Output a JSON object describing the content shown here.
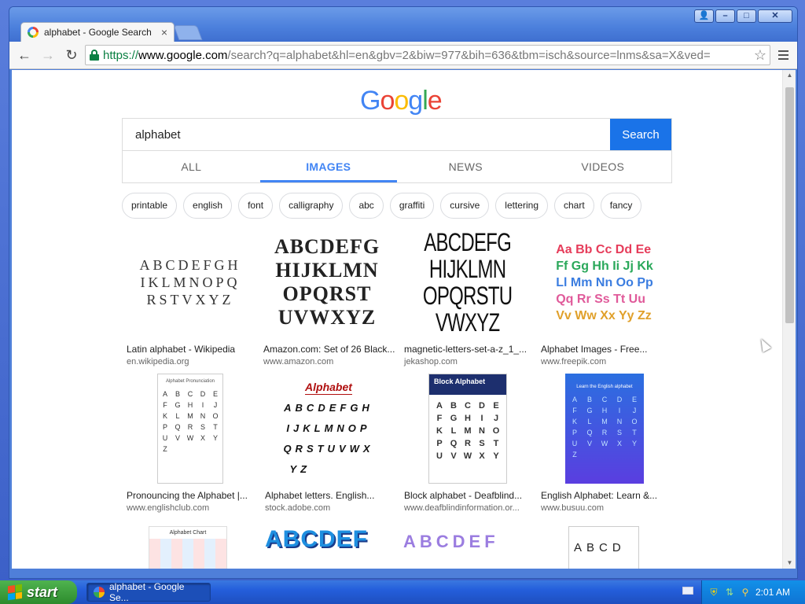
{
  "window": {
    "tab_title": "alphabet - Google Search",
    "tab_close": "×"
  },
  "toolbar": {
    "url_scheme": "https://",
    "url_host": "www.google.com",
    "url_path": "/search?q=alphabet&hl=en&gbv=2&biw=977&bih=636&tbm=isch&source=lnms&sa=X&ved=",
    "back": "←",
    "forward": "→",
    "reload": "↻",
    "star": "☆"
  },
  "page": {
    "logo": [
      "G",
      "o",
      "o",
      "g",
      "l",
      "e"
    ],
    "search": {
      "value": "alphabet",
      "button": "Search"
    },
    "tabs": [
      "ALL",
      "IMAGES",
      "NEWS",
      "VIDEOS"
    ],
    "active_tab": "IMAGES",
    "chips": [
      "printable",
      "english",
      "font",
      "calligraphy",
      "abc",
      "graffiti",
      "cursive",
      "lettering",
      "chart",
      "fancy"
    ],
    "results": [
      {
        "caption": "Latin alphabet - Wikipedia",
        "source": "en.wikipedia.org"
      },
      {
        "caption": "Amazon.com: Set of 26 Black...",
        "source": "www.amazon.com"
      },
      {
        "caption": "magnetic-letters-set-a-z_1_...",
        "source": "jekashop.com"
      },
      {
        "caption": "Alphabet Images - Free...",
        "source": "www.freepik.com"
      },
      {
        "caption": "Pronouncing the Alphabet |...",
        "source": "www.englishclub.com"
      },
      {
        "caption": "Alphabet letters. English...",
        "source": "stock.adobe.com"
      },
      {
        "caption": "Block alphabet - Deafblind...",
        "source": "www.deafblindinformation.or..."
      },
      {
        "caption": "English Alphabet: Learn &...",
        "source": "www.busuu.com"
      }
    ],
    "thumb_text": {
      "latin": [
        "ABCDEFGH",
        "IKLMNOPQ",
        "RSTVXYZ"
      ],
      "bold": [
        "ABCDEFG",
        "HIJKLMN",
        "OPQRST",
        "UVWXYZ"
      ],
      "tall": [
        "ABCDEFG",
        "HIJKLMN",
        "OPQRSTU",
        "VWXYZ"
      ],
      "color_pairs": [
        "Aa Bb Cc Dd Ee",
        "Ff Gg Hh Ii Jj Kk",
        "Ll Mm Nn Oo Pp",
        "Qq Rr Ss Tt Uu",
        "Vv Ww Xx Yy Zz"
      ],
      "pron_title": "Alphabet Pronunciation",
      "pron_letters": [
        "A",
        "B",
        "C",
        "D",
        "E",
        "F",
        "G",
        "H",
        "I",
        "J",
        "K",
        "L",
        "M",
        "N",
        "O",
        "P",
        "Q",
        "R",
        "S",
        "T",
        "U",
        "V",
        "W",
        "X",
        "Y",
        "Z"
      ],
      "hand_title": "Alphabet",
      "hand_rows": [
        "ABCDEFGH",
        "IJKLMNOP",
        "QRSTUVWX",
        "YZ"
      ],
      "block_title": "Block Alphabet",
      "busuu_title": "Learn the English alphabet",
      "chart_title": "Alphabet Chart",
      "row3_colorful": "ABCDEF",
      "row3_grid": "ABCD"
    }
  },
  "taskbar": {
    "start": "start",
    "task_title": "alphabet - Google Se...",
    "clock": "2:01 AM"
  }
}
